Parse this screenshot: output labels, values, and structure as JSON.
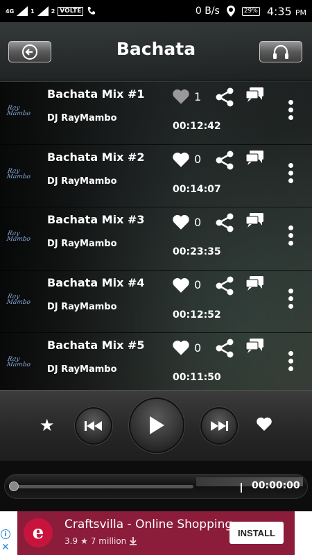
{
  "status_bar": {
    "network": "4G",
    "sim1": "1",
    "sim2": "2",
    "volte": "VOLTE",
    "data_speed": "0 B/s",
    "battery": "29%",
    "time": "4:35",
    "ampm": "PM"
  },
  "header": {
    "title": "Bachata",
    "back_icon": "back-arrow-icon",
    "right_icon": "headphones-icon"
  },
  "tracks": [
    {
      "title": "Bachata Mix #1",
      "artist": "DJ RayMambo",
      "duration": "00:12:42",
      "likes": "1",
      "liked": true
    },
    {
      "title": "Bachata Mix #2",
      "artist": "DJ RayMambo",
      "duration": "00:14:07",
      "likes": "0",
      "liked": false
    },
    {
      "title": "Bachata Mix #3",
      "artist": "DJ RayMambo",
      "duration": "00:23:35",
      "likes": "0",
      "liked": false
    },
    {
      "title": "Bachata Mix #4",
      "artist": "DJ RayMambo",
      "duration": "00:12:52",
      "likes": "0",
      "liked": false
    },
    {
      "title": "Bachata Mix #5",
      "artist": "DJ RayMambo",
      "duration": "00:11:50",
      "likes": "0",
      "liked": false
    }
  ],
  "thumb_text": "Ray Mambo",
  "player": {
    "star_icon": "star-icon",
    "prev_icon": "previous-icon",
    "play_icon": "play-icon",
    "next_icon": "next-icon",
    "heart_icon": "heart-icon",
    "elapsed": "00:00:00",
    "progress": 0
  },
  "ad": {
    "title": "Craftsvilla - Online Shopping",
    "rating": "3.9",
    "installs": "7 million",
    "install_label": "INSTALL",
    "info": "i",
    "close": "✕",
    "logo_letter": "e",
    "accent": "#8b1d3a"
  }
}
